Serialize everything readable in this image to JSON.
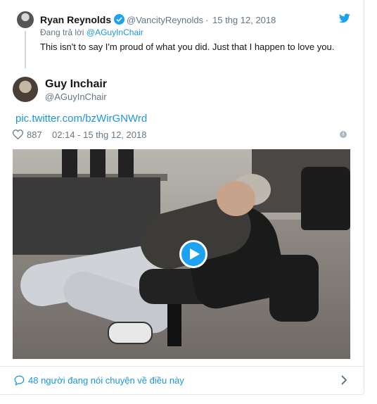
{
  "reply_tweet": {
    "author_name": "Ryan Reynolds",
    "author_handle": "@VancityReynolds",
    "separator": "·",
    "date": "15 thg 12, 2018",
    "reply_prefix": "Đang trả lời ",
    "reply_to": "@AGuyInChair",
    "text": "This isn't to say I'm proud of what you did. Just that I happen to love you."
  },
  "main_tweet": {
    "author_name": "Guy Inchair",
    "author_handle": "@AGuyInChair",
    "pic_link": "pic.twitter.com/bzWirGNWrd",
    "likes": "887",
    "timestamp": "02:14 - 15 thg 12, 2018",
    "info_glyph": "i"
  },
  "footer": {
    "conversation_text": "48 người đang nói chuyện về điều này"
  },
  "colors": {
    "link": "#1b95e0",
    "verified": "#1da1f2",
    "secondary_text": "#657786"
  },
  "icons": [
    "twitter-bird-icon",
    "verified-badge-icon",
    "heart-icon",
    "info-icon",
    "play-icon",
    "speech-bubble-icon",
    "chevron-right-icon"
  ]
}
